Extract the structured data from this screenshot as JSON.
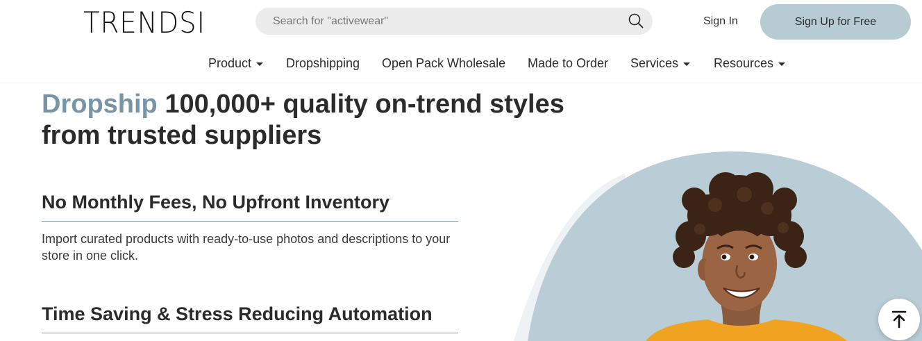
{
  "header": {
    "logo": "TRENDSI",
    "search": {
      "placeholder": "Search for \"activewear\""
    },
    "sign_in": "Sign In",
    "sign_up": "Sign Up for Free"
  },
  "nav": {
    "items": [
      {
        "label": "Product",
        "dropdown": true
      },
      {
        "label": "Dropshipping",
        "dropdown": false
      },
      {
        "label": "Open Pack Wholesale",
        "dropdown": false
      },
      {
        "label": "Made to Order",
        "dropdown": false
      },
      {
        "label": "Services",
        "dropdown": true
      },
      {
        "label": "Resources",
        "dropdown": true
      }
    ]
  },
  "hero": {
    "accent": "Dropship",
    "title_rest_line1": " 100,000+ quality on-trend styles",
    "title_line2": "from trusted suppliers"
  },
  "features": [
    {
      "title": "No Monthly Fees, No Upfront Inventory",
      "description": "Import curated products with ready-to-use photos and descriptions to your store in one click."
    },
    {
      "title": "Time Saving & Stress Reducing Automation",
      "description": ""
    }
  ],
  "colors": {
    "accent": "#7894a7",
    "signup_bg": "#b7cbd3",
    "blob": "#b9cdd6",
    "blob_light": "#eef2f4",
    "sweater": "#f0a321"
  },
  "icons": {
    "search": "search-icon",
    "scroll_top": "arrow-up-to-top-icon"
  }
}
